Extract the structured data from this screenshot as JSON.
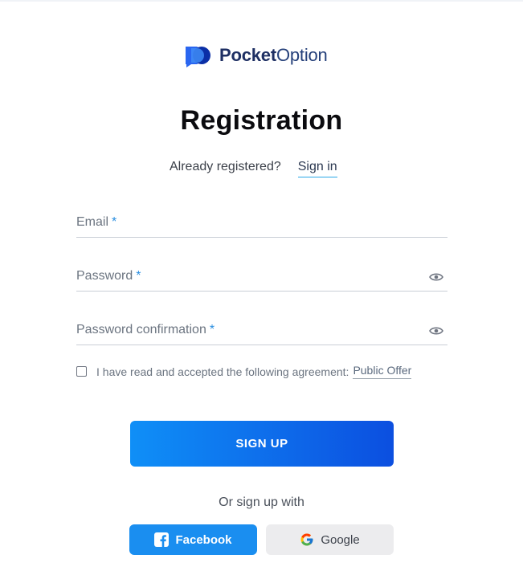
{
  "brand": {
    "name_bold": "Pocket",
    "name_light": "Option",
    "logo_icon": "pocketoption-logo-icon",
    "colors": {
      "navy": "#1e2f63",
      "accent": "#1a8ef0",
      "logo_dark": "#0b2fa6"
    }
  },
  "page": {
    "title": "Registration",
    "already_text": "Already registered?",
    "signin_label": "Sign in"
  },
  "form": {
    "email": {
      "label": "Email",
      "required_mark": "*"
    },
    "password": {
      "label": "Password",
      "required_mark": "*",
      "icon": "eye-icon"
    },
    "password_confirmation": {
      "label": "Password confirmation",
      "required_mark": "*",
      "icon": "eye-icon"
    },
    "agreement": {
      "checked": false,
      "text": "I have read and accepted the following agreement:",
      "link_label": "Public Offer"
    },
    "submit_label": "SIGN UP"
  },
  "social": {
    "or_text": "Or sign up with",
    "facebook_label": "Facebook",
    "facebook_icon": "facebook-icon",
    "google_label": "Google",
    "google_icon": "google-icon"
  }
}
